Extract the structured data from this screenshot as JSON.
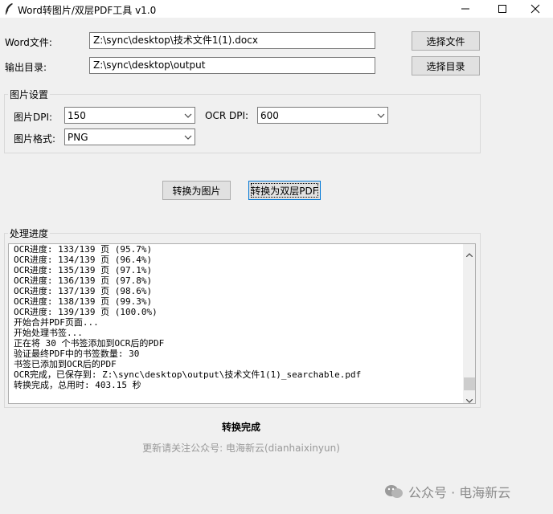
{
  "window": {
    "title": "Word转图片/双层PDF工具 v1.0",
    "icon": "feather-icon"
  },
  "form": {
    "word_label": "Word文件:",
    "word_value": "Z:\\sync\\desktop\\技术文件1(1).docx",
    "word_button": "选择文件",
    "out_label": "输出目录:",
    "out_value": "Z:\\sync\\desktop\\output",
    "out_button": "选择目录"
  },
  "image_settings": {
    "title": "图片设置",
    "dpi_label": "图片DPI:",
    "dpi_value": "150",
    "ocr_label": "OCR DPI:",
    "ocr_value": "600",
    "format_label": "图片格式:",
    "format_value": "PNG"
  },
  "actions": {
    "to_image": "转换为图片",
    "to_pdf": "转换为双层PDF"
  },
  "progress": {
    "title": "处理进度",
    "lines": [
      "OCR进度: 133/139 页 (95.7%)",
      "OCR进度: 134/139 页 (96.4%)",
      "OCR进度: 135/139 页 (97.1%)",
      "OCR进度: 136/139 页 (97.8%)",
      "OCR进度: 137/139 页 (98.6%)",
      "OCR进度: 138/139 页 (99.3%)",
      "OCR进度: 139/139 页 (100.0%)",
      "开始合并PDF页面...",
      "开始处理书签...",
      "正在将 30 个书签添加到OCR后的PDF",
      "验证最终PDF中的书签数量: 30",
      "书签已添加到OCR后的PDF",
      "OCR完成，已保存到: Z:\\sync\\desktop\\output\\技术文件1(1)_searchable.pdf",
      "转换完成，总用时: 403.15 秒"
    ]
  },
  "status": "转换完成",
  "footer": "更新请关注公众号: 电海新云(dianhaixinyun)",
  "watermark": "公众号 · 电海新云"
}
